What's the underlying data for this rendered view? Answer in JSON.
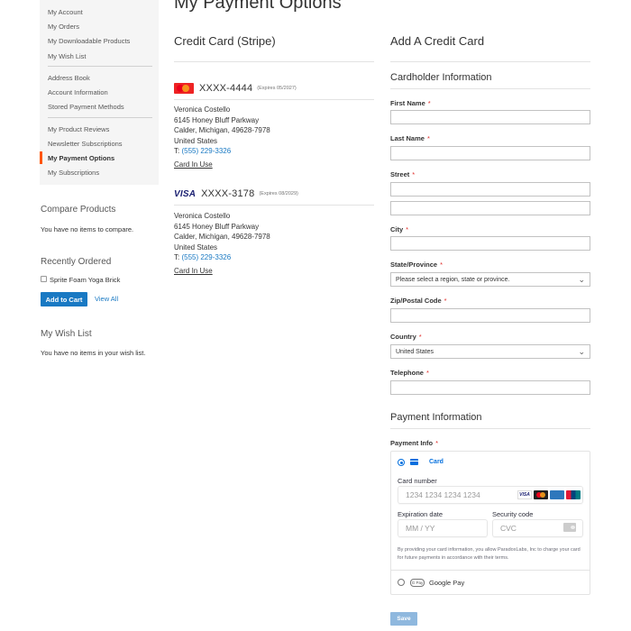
{
  "sidebar": {
    "nav": [
      {
        "label": "My Account"
      },
      {
        "label": "My Orders"
      },
      {
        "label": "My Downloadable Products"
      },
      {
        "label": "My Wish List"
      },
      {
        "label": "Address Book"
      },
      {
        "label": "Account Information"
      },
      {
        "label": "Stored Payment Methods"
      },
      {
        "label": "My Product Reviews"
      },
      {
        "label": "Newsletter Subscriptions"
      },
      {
        "label": "My Payment Options",
        "active": true
      },
      {
        "label": "My Subscriptions"
      }
    ],
    "compare": {
      "title": "Compare Products",
      "empty": "You have no items to compare."
    },
    "recently_ordered": {
      "title": "Recently Ordered",
      "item": "Sprite Foam Yoga Brick",
      "add_to_cart": "Add to Cart",
      "view_all": "View All"
    },
    "wishlist": {
      "title": "My Wish List",
      "empty": "You have no items in your wish list."
    }
  },
  "page": {
    "title": "My Payment Options"
  },
  "saved_cards": {
    "title": "Credit Card (Stripe)",
    "cards": [
      {
        "brand": "mastercard-icon",
        "number": "XXXX-4444",
        "expires": "(Expires 05/2027)",
        "name": "Veronica Costello",
        "street": "6145 Honey Bluff Parkway",
        "city_line": "Calder, Michigan, 49628-7978",
        "country": "United States",
        "tel_prefix": "T: ",
        "tel": "(555) 229-3326",
        "status": "Card In Use"
      },
      {
        "brand": "visa-icon",
        "brand_text": "VISA",
        "number": "XXXX-3178",
        "expires": "(Expires 08/2029)",
        "name": "Veronica Costello",
        "street": "6145 Honey Bluff Parkway",
        "city_line": "Calder, Michigan, 49628-7978",
        "country": "United States",
        "tel_prefix": "T: ",
        "tel": "(555) 229-3326",
        "status": "Card In Use"
      }
    ]
  },
  "add_card": {
    "title": "Add A Credit Card",
    "cardholder_title": "Cardholder Information",
    "fields": {
      "first_name": {
        "label": "First Name",
        "value": ""
      },
      "last_name": {
        "label": "Last Name",
        "value": ""
      },
      "street": {
        "label": "Street",
        "value": ""
      },
      "city": {
        "label": "City",
        "value": ""
      },
      "region": {
        "label": "State/Province",
        "value": "Please select a region, state or province."
      },
      "zip": {
        "label": "Zip/Postal Code",
        "value": ""
      },
      "country": {
        "label": "Country",
        "value": "United States"
      },
      "telephone": {
        "label": "Telephone",
        "value": ""
      }
    },
    "required_mark": "*",
    "payment_title": "Payment Information",
    "payment_info_label": "Payment Info",
    "payment": {
      "card_tab": "Card",
      "card_number_label": "Card number",
      "card_number_placeholder": "1234 1234 1234 1234",
      "brand_visa": "VISA",
      "expiry_label": "Expiration date",
      "expiry_placeholder": "MM / YY",
      "cvc_label": "Security code",
      "cvc_placeholder": "CVC",
      "note": "By providing your card information, you allow ParadoxLabs, Inc to charge your card for future payments in accordance with their terms.",
      "gpay_badge": "G Pay",
      "gpay_label": "Google Pay"
    },
    "save": "Save"
  },
  "colors": {
    "accent": "#1979c3",
    "active_nav": "#ff5501",
    "stripe_blue": "#0570de",
    "required": "#e02b27"
  }
}
